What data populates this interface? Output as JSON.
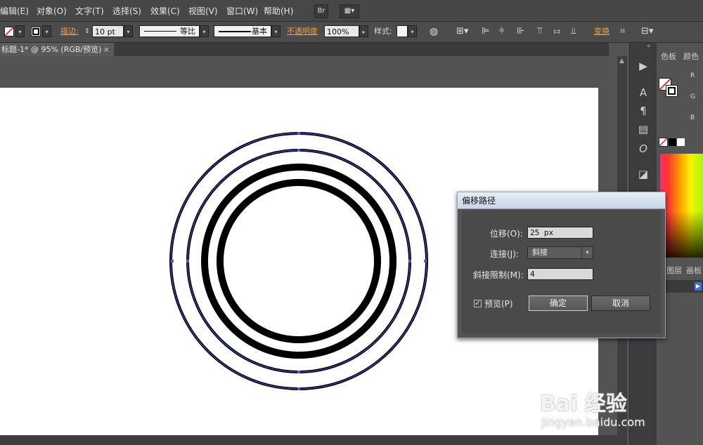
{
  "menu": {
    "items": [
      {
        "label": "编辑(E)"
      },
      {
        "label": "对象(O)"
      },
      {
        "label": "文字(T)"
      },
      {
        "label": "选择(S)"
      },
      {
        "label": "效果(C)"
      },
      {
        "label": "视图(V)"
      },
      {
        "label": "窗口(W)"
      },
      {
        "label": "帮助(H)"
      }
    ],
    "bridge_label": "Br"
  },
  "toolbar": {
    "stroke_label": "描边:",
    "stroke_weight": "10 pt",
    "profile_label": "等比",
    "brush_label": "基本",
    "opacity_label": "不透明度",
    "opacity_value": "100%",
    "style_label": "样式:",
    "transform_label": "变换"
  },
  "document": {
    "tab_label": "标题-1* @ 95% (RGB/预览)",
    "close_glyph": "×"
  },
  "panels": {
    "swatch_tab": "色板",
    "color_tab": "颜色",
    "rgb_labels": [
      "R",
      "G",
      "B"
    ],
    "layers_tab": "图层",
    "artboards_tab": "画板"
  },
  "dialog": {
    "title": "偏移路径",
    "offset_label": "位移(O):",
    "offset_value": "25 px",
    "joins_label": "连接(J):",
    "joins_value": "斜接",
    "miter_label": "斜接限制(M):",
    "miter_value": "4",
    "preview_label": "预览(P)",
    "preview_checked": true,
    "ok_label": "确定",
    "cancel_label": "取消"
  },
  "watermark": {
    "brand": "Bai 经验",
    "url": "jingyan.baidu.com"
  },
  "colors": {
    "path_selection": "#4a5cd6",
    "stroke": "#000000"
  }
}
